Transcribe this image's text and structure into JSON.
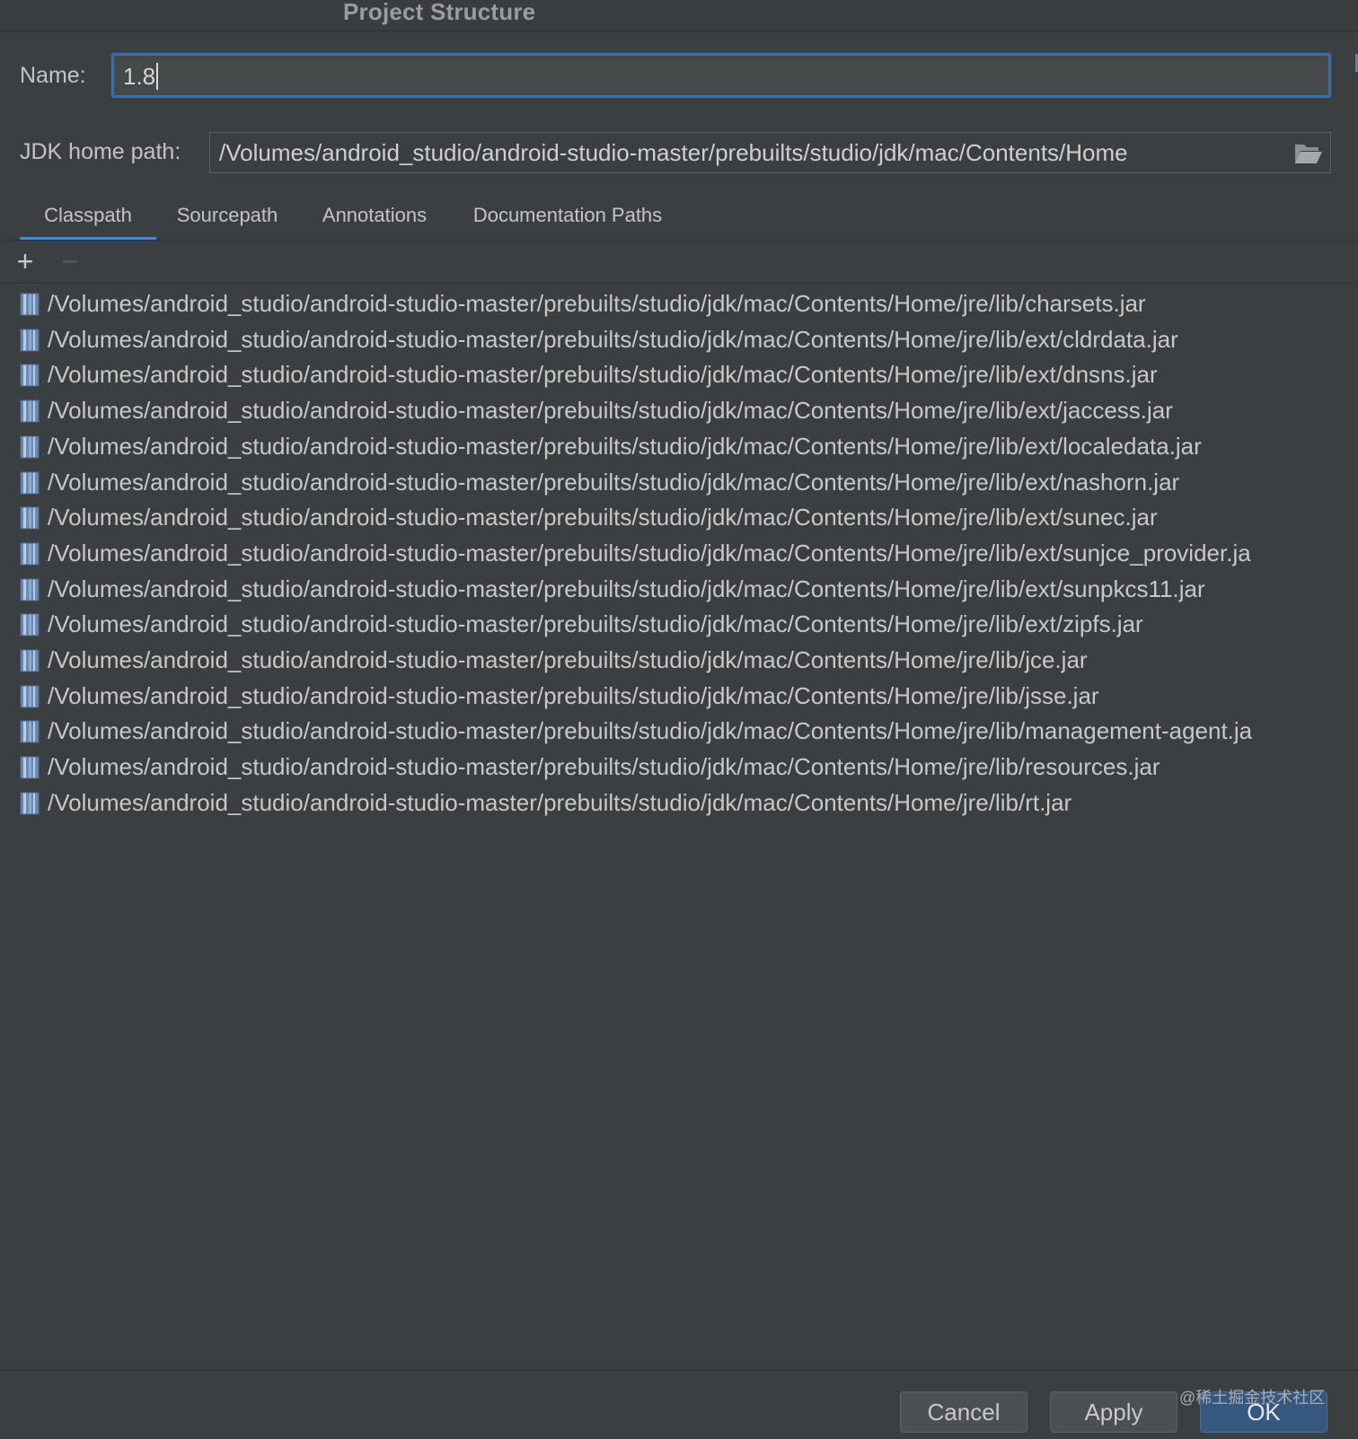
{
  "window": {
    "title": "Project Structure"
  },
  "form": {
    "name_label": "Name:",
    "name_value": "1.8",
    "jdk_label": "JDK home path:",
    "jdk_value": "/Volumes/android_studio/android-studio-master/prebuilts/studio/jdk/mac/Contents/Home"
  },
  "tabs": [
    {
      "label": "Classpath",
      "active": true
    },
    {
      "label": "Sourcepath",
      "active": false
    },
    {
      "label": "Annotations",
      "active": false
    },
    {
      "label": "Documentation Paths",
      "active": false
    }
  ],
  "toolbar": {
    "add_label": "+",
    "remove_label": "−"
  },
  "classpath": [
    "/Volumes/android_studio/android-studio-master/prebuilts/studio/jdk/mac/Contents/Home/jre/lib/charsets.jar",
    "/Volumes/android_studio/android-studio-master/prebuilts/studio/jdk/mac/Contents/Home/jre/lib/ext/cldrdata.jar",
    "/Volumes/android_studio/android-studio-master/prebuilts/studio/jdk/mac/Contents/Home/jre/lib/ext/dnsns.jar",
    "/Volumes/android_studio/android-studio-master/prebuilts/studio/jdk/mac/Contents/Home/jre/lib/ext/jaccess.jar",
    "/Volumes/android_studio/android-studio-master/prebuilts/studio/jdk/mac/Contents/Home/jre/lib/ext/localedata.jar",
    "/Volumes/android_studio/android-studio-master/prebuilts/studio/jdk/mac/Contents/Home/jre/lib/ext/nashorn.jar",
    "/Volumes/android_studio/android-studio-master/prebuilts/studio/jdk/mac/Contents/Home/jre/lib/ext/sunec.jar",
    "/Volumes/android_studio/android-studio-master/prebuilts/studio/jdk/mac/Contents/Home/jre/lib/ext/sunjce_provider.ja",
    "/Volumes/android_studio/android-studio-master/prebuilts/studio/jdk/mac/Contents/Home/jre/lib/ext/sunpkcs11.jar",
    "/Volumes/android_studio/android-studio-master/prebuilts/studio/jdk/mac/Contents/Home/jre/lib/ext/zipfs.jar",
    "/Volumes/android_studio/android-studio-master/prebuilts/studio/jdk/mac/Contents/Home/jre/lib/jce.jar",
    "/Volumes/android_studio/android-studio-master/prebuilts/studio/jdk/mac/Contents/Home/jre/lib/jsse.jar",
    "/Volumes/android_studio/android-studio-master/prebuilts/studio/jdk/mac/Contents/Home/jre/lib/management-agent.ja",
    "/Volumes/android_studio/android-studio-master/prebuilts/studio/jdk/mac/Contents/Home/jre/lib/resources.jar",
    "/Volumes/android_studio/android-studio-master/prebuilts/studio/jdk/mac/Contents/Home/jre/lib/rt.jar"
  ],
  "buttons": {
    "cancel": "Cancel",
    "apply": "Apply",
    "ok": "OK"
  },
  "watermark": "@稀土掘金技术社区",
  "colors": {
    "background": "#3c3f41",
    "focus_border": "#3d6da3",
    "tab_underline": "#4a88c7",
    "primary_button": "#365880",
    "jar_icon": "#7a9cc6"
  }
}
